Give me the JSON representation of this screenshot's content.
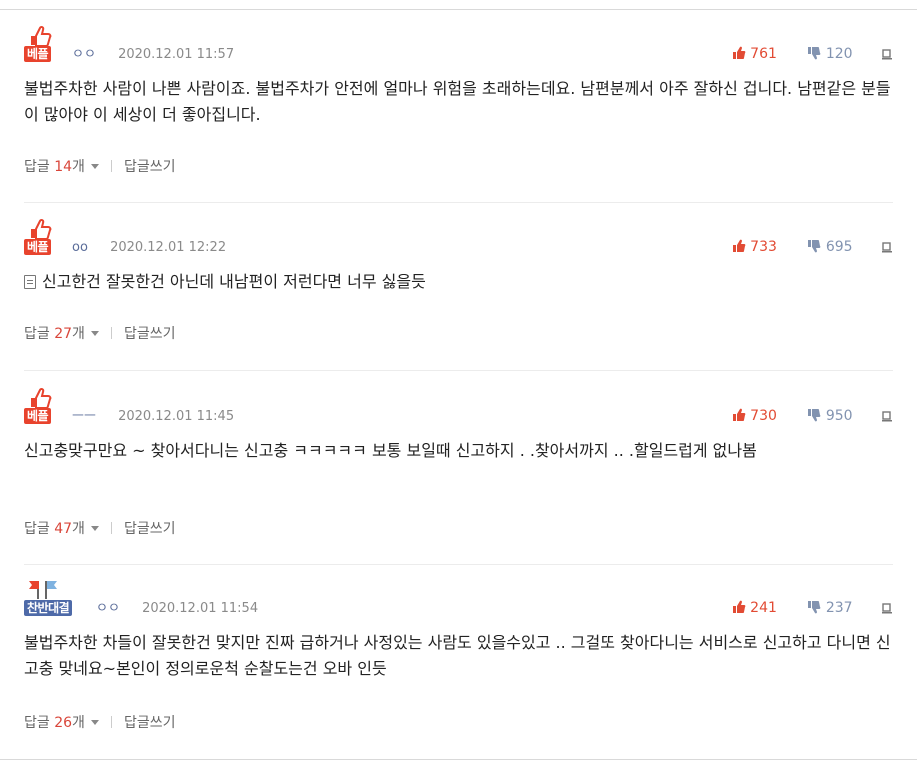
{
  "comments": [
    {
      "badge": "베플",
      "badge_type": "best",
      "nickname": "ㅇㅇ",
      "date": "2020.12.01 11:57",
      "up": "761",
      "down": "120",
      "text": "불법주차한 사람이 나쁜 사람이죠. 불법주차가 안전에 얼마나 위험을 초래하는데요. 남편분께서 아주 잘하신 겁니다. 남편같은 분들이 많아야 이 세상이 더 좋아집니다.",
      "reply_label": "답글",
      "reply_count": "14",
      "reply_unit": "개",
      "write_label": "답글쓰기"
    },
    {
      "badge": "베플",
      "badge_type": "best",
      "nickname": "oo",
      "date": "2020.12.01 12:22",
      "up": "733",
      "down": "695",
      "text": "신고한건 잘못한건 아닌데 내남편이 저런다면 너무 싫을듯",
      "reply_label": "답글",
      "reply_count": "27",
      "reply_unit": "개",
      "write_label": "답글쓰기"
    },
    {
      "badge": "베플",
      "badge_type": "best",
      "nickname": "ㅡㅡ",
      "date": "2020.12.01 11:45",
      "up": "730",
      "down": "950",
      "text": "신고충맞구만요 ~ 찾아서다니는 신고충 ㅋㅋㅋㅋㅋ 보통 보일때 신고하지 . .찾아서까지 .. .할일드럽게 없나봄",
      "reply_label": "답글",
      "reply_count": "47",
      "reply_unit": "개",
      "write_label": "답글쓰기"
    },
    {
      "badge": "찬반대결",
      "badge_type": "worst",
      "nickname": "ㅇㅇ",
      "date": "2020.12.01 11:54",
      "up": "241",
      "down": "237",
      "text": "불법주차한 차들이 잘못한건 맞지만 진짜 급하거나 사정있는 사람도 있을수있고 .. 그걸또 찾아다니는 서비스로 신고하고 다니면 신고충 맞네요~본인이 정의로운척 순찰도는건 오바 인듯",
      "reply_label": "답글",
      "reply_count": "26",
      "reply_unit": "개",
      "write_label": "답글쓰기"
    }
  ],
  "icons": {
    "thumb": "thumbs-up-icon",
    "up": "thumb-up-icon",
    "down": "thumb-down-icon",
    "report": "report-icon",
    "memo": "memo-icon",
    "flag": "flag-icon"
  },
  "colors": {
    "best_badge": "#e8432d",
    "worst_badge": "#4e6aa8",
    "up": "#e24b34",
    "down": "#8293b0",
    "reply_count": "#d9463a"
  }
}
